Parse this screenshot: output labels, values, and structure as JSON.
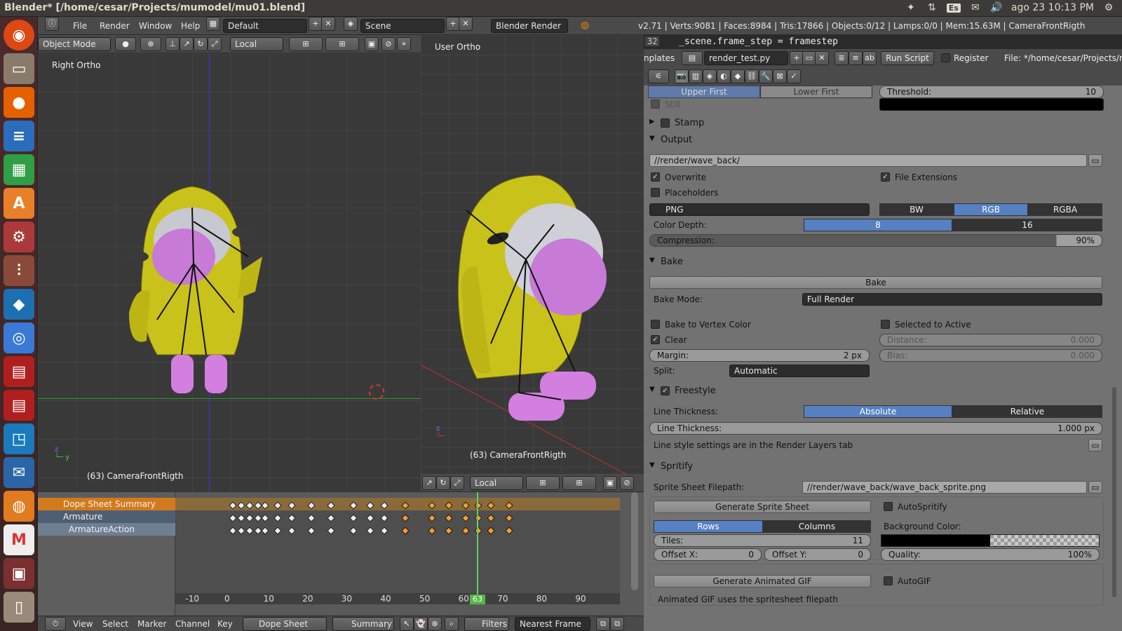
{
  "os": {
    "window_title": "Blender* [/home/cesar/Projects/mumodel/mu01.blend]",
    "keyboard_layout": "Es",
    "clock": "ago 23 10:13 PM"
  },
  "launcher": [
    "ubuntu-icon",
    "files-icon",
    "firefox-icon",
    "writer-icon",
    "calc-icon",
    "software-center-icon",
    "settings-icon",
    "system-monitor-icon",
    "virtualbox-icon",
    "chromium-icon",
    "filezilla-icon",
    "filezilla-icon",
    "appinventor-icon",
    "thunderbird-icon",
    "blender-icon",
    "gmail-icon",
    "workspace-icon",
    "trash-icon"
  ],
  "header": {
    "menus": [
      "File",
      "Render",
      "Window",
      "Help"
    ],
    "screen_layout": "Default",
    "scene": "Scene",
    "engine": "Blender Render",
    "stats": "v2.71 | Verts:9081 | Faces:8984 | Tris:17866 | Objects:0/12 | Lamps:0/0 | Mem:15.63M | CameraFrontRigth"
  },
  "viewport_left": {
    "mode": "Object Mode",
    "orientation": "Local",
    "label": "Right Ortho",
    "footer": "(63) CameraFrontRigth"
  },
  "viewport_right": {
    "label": "User Ortho",
    "footer": "(63) CameraFrontRigth",
    "orientation": "Local"
  },
  "text_editor": {
    "line_number": "32",
    "code": "_scene.frame_step = framestep",
    "templates_label": "nplates",
    "file_name": "render_test.py",
    "run_script": "Run Script",
    "register": "Register",
    "file_path": "File: */home/cesar/Projects/mumod"
  },
  "properties": {
    "field_order": {
      "upper": "Upper First",
      "lower": "Lower First"
    },
    "threshold": {
      "label": "Threshold:",
      "value": "10"
    },
    "still": "Still",
    "stamp": "Stamp",
    "output": {
      "title": "Output",
      "path": "//render/wave_back/",
      "overwrite": "Overwrite",
      "file_extensions": "File Extensions",
      "placeholders": "Placeholders",
      "format": "PNG",
      "color_modes": [
        "BW",
        "RGB",
        "RGBA"
      ],
      "color_depth_label": "Color Depth:",
      "color_depth": [
        "8",
        "16"
      ],
      "compression_label": "Compression:",
      "compression": "90%"
    },
    "bake": {
      "title": "Bake",
      "bake_button": "Bake",
      "mode_label": "Bake Mode:",
      "mode": "Full Render",
      "vertex_color": "Bake to Vertex Color",
      "selected_to_active": "Selected to Active",
      "clear": "Clear",
      "distance": {
        "label": "Distance:",
        "value": "0.000"
      },
      "margin": {
        "label": "Margin:",
        "value": "2 px"
      },
      "bias": {
        "label": "Bias:",
        "value": "0.000"
      },
      "split_label": "Split:",
      "split": "Automatic"
    },
    "freestyle": {
      "title": "Freestyle",
      "thickness_label": "Line Thickness:",
      "thickness_modes": [
        "Absolute",
        "Relative"
      ],
      "thickness_field": {
        "label": "Line Thickness:",
        "value": "1.000 px"
      },
      "note": "Line style settings are in the Render Layers tab"
    },
    "spritify": {
      "title": "Spritify",
      "filepath_label": "Sprite Sheet Filepath:",
      "filepath": "//render/wave_back/wave_back_sprite.png",
      "generate_sheet": "Generate Sprite Sheet",
      "autospritify": "AutoSpritify",
      "layout": [
        "Rows",
        "Columns"
      ],
      "bg_label": "Background Color:",
      "tiles": {
        "label": "Tiles:",
        "value": "11"
      },
      "offset_x": {
        "label": "Offset X:",
        "value": "0"
      },
      "offset_y": {
        "label": "Offset Y:",
        "value": "0"
      },
      "quality": {
        "label": "Quality:",
        "value": "100%"
      },
      "generate_gif": "Generate Animated GIF",
      "autogif": "AutoGIF",
      "gif_note": "Animated GIF uses the spritesheet filepath"
    }
  },
  "dopesheet": {
    "channels": [
      "Dope Sheet Summary",
      "Armature",
      "ArmatureAction"
    ],
    "ticks": [
      "-10",
      "0",
      "10",
      "20",
      "30",
      "40",
      "50",
      "60",
      "70",
      "80",
      "90"
    ],
    "current_frame": "63",
    "menus": [
      "View",
      "Select",
      "Marker",
      "Channel",
      "Key"
    ],
    "mode": "Dope Sheet",
    "summary": "Summary",
    "filters": "Filters",
    "snap": "Nearest Frame"
  }
}
